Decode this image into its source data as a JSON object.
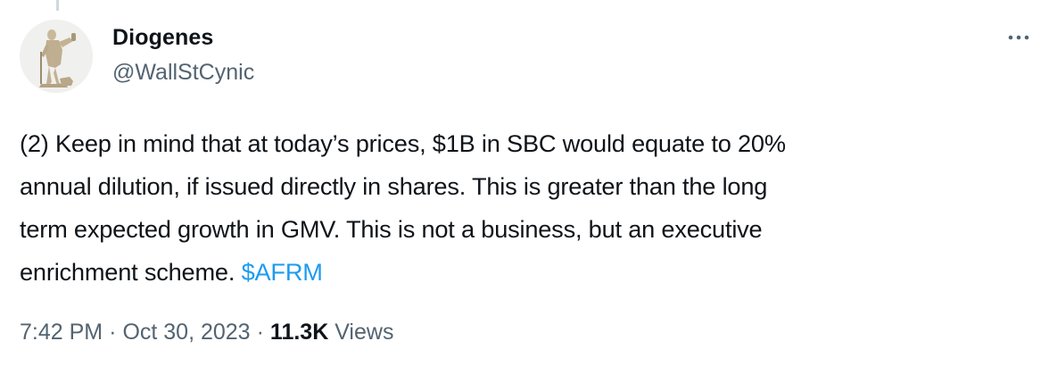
{
  "tweet": {
    "author": {
      "display_name": "Diogenes",
      "handle": "@WallStCynic",
      "avatar_icon": "statue-avatar-icon"
    },
    "more_icon": "more-horizontal-icon",
    "text_lines": [
      "(2) Keep in mind that at today’s prices, $1B in SBC would equate to 20%",
      "annual dilution, if issued directly in shares. This is greater than the long",
      "term expected growth in GMV. This is not a business, but an executive",
      "enrichment scheme. "
    ],
    "cashtag": "$AFRM",
    "time": "7:42 PM",
    "separator": "·",
    "date": "Oct 30, 2023",
    "views_count": "11.3K",
    "views_label": " Views"
  },
  "colors": {
    "text": "#0f1419",
    "secondary": "#536471",
    "link": "#1d9bf0"
  }
}
